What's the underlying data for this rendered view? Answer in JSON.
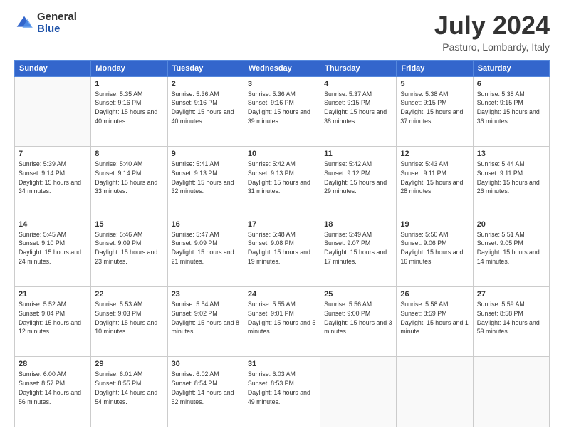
{
  "logo": {
    "general": "General",
    "blue": "Blue"
  },
  "header": {
    "month": "July 2024",
    "location": "Pasturo, Lombardy, Italy"
  },
  "weekdays": [
    "Sunday",
    "Monday",
    "Tuesday",
    "Wednesday",
    "Thursday",
    "Friday",
    "Saturday"
  ],
  "weeks": [
    [
      {
        "day": "",
        "detail": ""
      },
      {
        "day": "1",
        "detail": "Sunrise: 5:35 AM\nSunset: 9:16 PM\nDaylight: 15 hours\nand 40 minutes."
      },
      {
        "day": "2",
        "detail": "Sunrise: 5:36 AM\nSunset: 9:16 PM\nDaylight: 15 hours\nand 40 minutes."
      },
      {
        "day": "3",
        "detail": "Sunrise: 5:36 AM\nSunset: 9:16 PM\nDaylight: 15 hours\nand 39 minutes."
      },
      {
        "day": "4",
        "detail": "Sunrise: 5:37 AM\nSunset: 9:15 PM\nDaylight: 15 hours\nand 38 minutes."
      },
      {
        "day": "5",
        "detail": "Sunrise: 5:38 AM\nSunset: 9:15 PM\nDaylight: 15 hours\nand 37 minutes."
      },
      {
        "day": "6",
        "detail": "Sunrise: 5:38 AM\nSunset: 9:15 PM\nDaylight: 15 hours\nand 36 minutes."
      }
    ],
    [
      {
        "day": "7",
        "detail": "Sunrise: 5:39 AM\nSunset: 9:14 PM\nDaylight: 15 hours\nand 34 minutes."
      },
      {
        "day": "8",
        "detail": "Sunrise: 5:40 AM\nSunset: 9:14 PM\nDaylight: 15 hours\nand 33 minutes."
      },
      {
        "day": "9",
        "detail": "Sunrise: 5:41 AM\nSunset: 9:13 PM\nDaylight: 15 hours\nand 32 minutes."
      },
      {
        "day": "10",
        "detail": "Sunrise: 5:42 AM\nSunset: 9:13 PM\nDaylight: 15 hours\nand 31 minutes."
      },
      {
        "day": "11",
        "detail": "Sunrise: 5:42 AM\nSunset: 9:12 PM\nDaylight: 15 hours\nand 29 minutes."
      },
      {
        "day": "12",
        "detail": "Sunrise: 5:43 AM\nSunset: 9:11 PM\nDaylight: 15 hours\nand 28 minutes."
      },
      {
        "day": "13",
        "detail": "Sunrise: 5:44 AM\nSunset: 9:11 PM\nDaylight: 15 hours\nand 26 minutes."
      }
    ],
    [
      {
        "day": "14",
        "detail": "Sunrise: 5:45 AM\nSunset: 9:10 PM\nDaylight: 15 hours\nand 24 minutes."
      },
      {
        "day": "15",
        "detail": "Sunrise: 5:46 AM\nSunset: 9:09 PM\nDaylight: 15 hours\nand 23 minutes."
      },
      {
        "day": "16",
        "detail": "Sunrise: 5:47 AM\nSunset: 9:09 PM\nDaylight: 15 hours\nand 21 minutes."
      },
      {
        "day": "17",
        "detail": "Sunrise: 5:48 AM\nSunset: 9:08 PM\nDaylight: 15 hours\nand 19 minutes."
      },
      {
        "day": "18",
        "detail": "Sunrise: 5:49 AM\nSunset: 9:07 PM\nDaylight: 15 hours\nand 17 minutes."
      },
      {
        "day": "19",
        "detail": "Sunrise: 5:50 AM\nSunset: 9:06 PM\nDaylight: 15 hours\nand 16 minutes."
      },
      {
        "day": "20",
        "detail": "Sunrise: 5:51 AM\nSunset: 9:05 PM\nDaylight: 15 hours\nand 14 minutes."
      }
    ],
    [
      {
        "day": "21",
        "detail": "Sunrise: 5:52 AM\nSunset: 9:04 PM\nDaylight: 15 hours\nand 12 minutes."
      },
      {
        "day": "22",
        "detail": "Sunrise: 5:53 AM\nSunset: 9:03 PM\nDaylight: 15 hours\nand 10 minutes."
      },
      {
        "day": "23",
        "detail": "Sunrise: 5:54 AM\nSunset: 9:02 PM\nDaylight: 15 hours\nand 8 minutes."
      },
      {
        "day": "24",
        "detail": "Sunrise: 5:55 AM\nSunset: 9:01 PM\nDaylight: 15 hours\nand 5 minutes."
      },
      {
        "day": "25",
        "detail": "Sunrise: 5:56 AM\nSunset: 9:00 PM\nDaylight: 15 hours\nand 3 minutes."
      },
      {
        "day": "26",
        "detail": "Sunrise: 5:58 AM\nSunset: 8:59 PM\nDaylight: 15 hours\nand 1 minute."
      },
      {
        "day": "27",
        "detail": "Sunrise: 5:59 AM\nSunset: 8:58 PM\nDaylight: 14 hours\nand 59 minutes."
      }
    ],
    [
      {
        "day": "28",
        "detail": "Sunrise: 6:00 AM\nSunset: 8:57 PM\nDaylight: 14 hours\nand 56 minutes."
      },
      {
        "day": "29",
        "detail": "Sunrise: 6:01 AM\nSunset: 8:55 PM\nDaylight: 14 hours\nand 54 minutes."
      },
      {
        "day": "30",
        "detail": "Sunrise: 6:02 AM\nSunset: 8:54 PM\nDaylight: 14 hours\nand 52 minutes."
      },
      {
        "day": "31",
        "detail": "Sunrise: 6:03 AM\nSunset: 8:53 PM\nDaylight: 14 hours\nand 49 minutes."
      },
      {
        "day": "",
        "detail": ""
      },
      {
        "day": "",
        "detail": ""
      },
      {
        "day": "",
        "detail": ""
      }
    ]
  ]
}
